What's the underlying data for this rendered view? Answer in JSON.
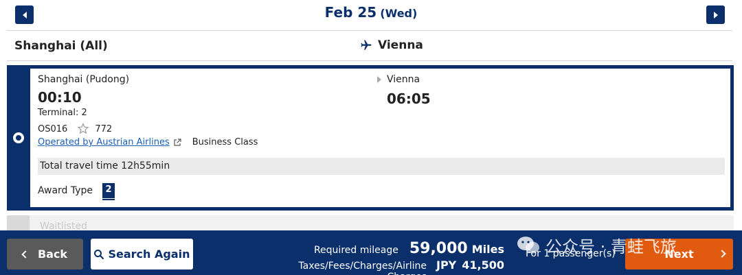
{
  "header": {
    "date": "Feb 25",
    "day": "(Wed)",
    "origin": "Shanghai (All)",
    "destination": "Vienna"
  },
  "flight": {
    "departure_airport": "Shanghai (Pudong)",
    "departure_time": "00:10",
    "terminal": "Terminal: 2",
    "flight_number": "OS016",
    "aircraft": "772",
    "operated_by": "Operated by Austrian Airlines",
    "cabin": "Business Class",
    "arrival_airport": "Vienna",
    "arrival_time": "06:05",
    "travel_time": "Total travel time 12h55min",
    "award_type_label": "Award Type",
    "award_type_value": "2"
  },
  "next_row": {
    "status": "Waitlisted"
  },
  "footer": {
    "back_label": "Back",
    "search_again_label": "Search Again",
    "required_mileage_label": "Required mileage",
    "required_mileage_value": "59,000",
    "required_mileage_unit": "Miles",
    "taxes_label": "Taxes/Fees/Charges/Airline Charges",
    "taxes_currency": "JPY",
    "taxes_amount": "41,500",
    "passengers": "For 1 passenger(s)",
    "next_label": "Next"
  },
  "watermark": {
    "text": "公众号 · 青蛙飞旅"
  },
  "colors": {
    "navy": "#0a2f6b",
    "orange": "#e05a10",
    "gray_button": "#5a5a5a",
    "link": "#1a5fb4"
  }
}
